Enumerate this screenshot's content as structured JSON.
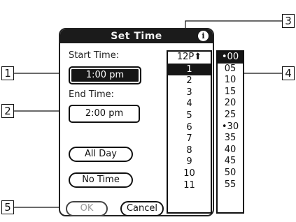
{
  "dialog": {
    "title": "Set Time",
    "start_label": "Start Time:",
    "start_value": "1:00 pm",
    "end_label": "End Time:",
    "end_value": "2:00 pm",
    "all_day_label": "All Day",
    "no_time_label": "No Time",
    "ok_label": "OK",
    "cancel_label": "Cancel"
  },
  "hour_list": {
    "header": "12P",
    "items": [
      "1",
      "2",
      "3",
      "4",
      "5",
      "6",
      "7",
      "8",
      "9",
      "10",
      "11"
    ],
    "selected": "1"
  },
  "minute_list": {
    "items": [
      "•00",
      "05",
      "10",
      "15",
      "20",
      "25",
      "•30",
      "35",
      "40",
      "45",
      "50",
      "55"
    ],
    "selected": "•00"
  },
  "callouts": [
    "1",
    "2",
    "3",
    "4",
    "5"
  ],
  "icons": {
    "info": "info-icon",
    "scroll_up": "scroll-up-arrow-icon"
  }
}
